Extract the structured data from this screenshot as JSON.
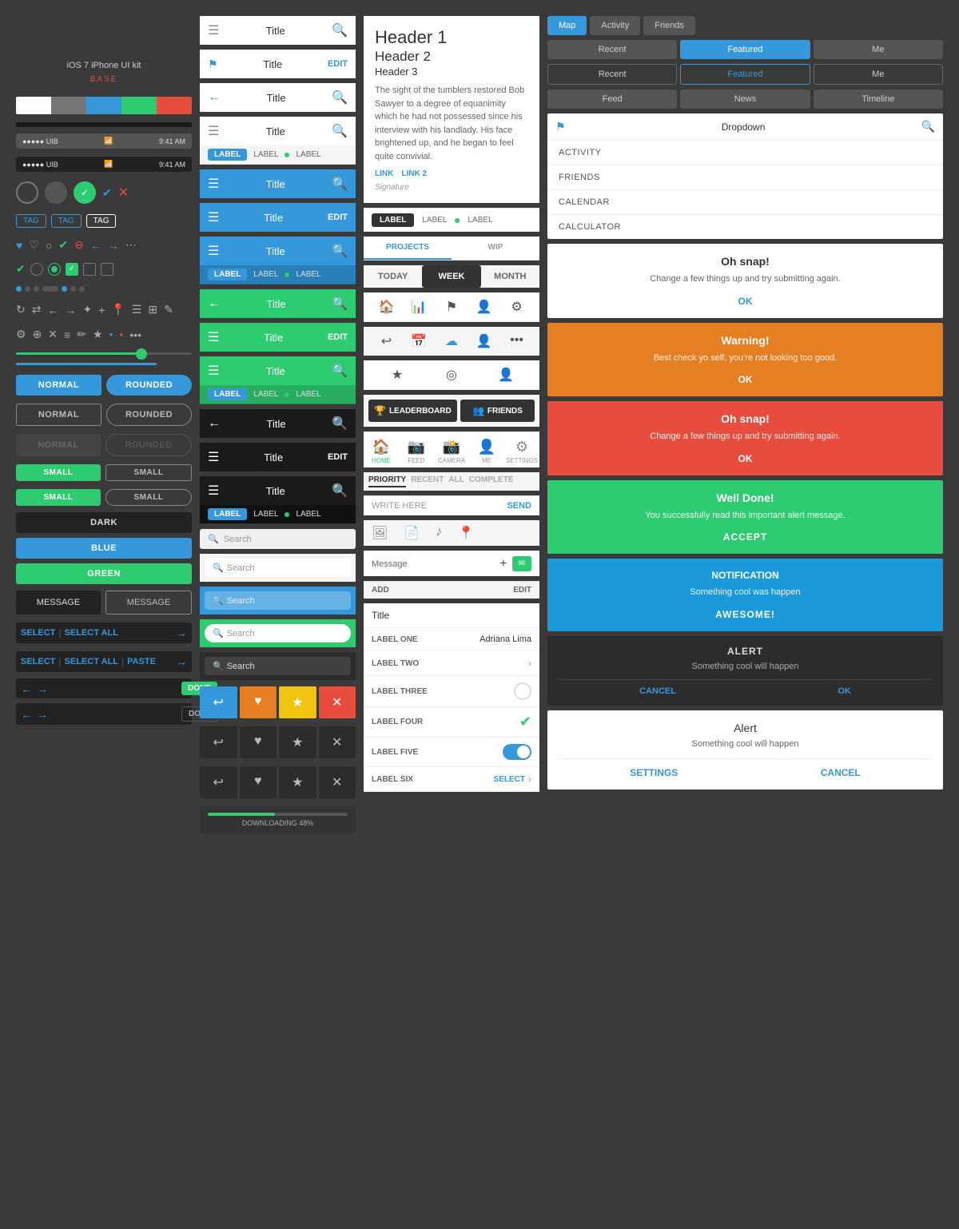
{
  "kit": {
    "title": "iOS 7 iPhone UI kit",
    "subtitle": "BASE",
    "colors": [
      "#fff",
      "#777",
      "#3498db",
      "#2ecc71",
      "#e74c3c"
    ],
    "phone_status": "9:41 AM",
    "phone_carrier": "UIB"
  },
  "buttons": {
    "normal": "NORMAL",
    "rounded": "ROUNDED",
    "dark": "DARK",
    "blue": "BLUE",
    "green": "GREEN",
    "small": "SMALL",
    "message": "MESSAGE",
    "select": "SELECT",
    "select_all": "SELECT ALL",
    "paste": "PASTE",
    "done": "DONE"
  },
  "nav": {
    "title": "Title",
    "edit": "EDIT",
    "label": "LABEL",
    "search_placeholder": "Search"
  },
  "article": {
    "header1": "Header 1",
    "header2": "Header 2",
    "header3": "Header 3",
    "body": "The sight of the tumblers restored Bob Sawyer to a degree of equanimity which he had not possessed since his interview with his landlady. His face brightened up, and he began to feel quite convivial.",
    "link1": "LINK",
    "link2": "LINK 2",
    "signature": "Signature"
  },
  "tabs": {
    "projects": "PROJECTS",
    "wip": "WIP",
    "today": "TODAY",
    "week": "WEEK",
    "month": "MONTH",
    "priority": "PRIORITY",
    "recent": "RECENT",
    "all": "ALL",
    "complete": "COMPLETE"
  },
  "col4_tabs": {
    "map": "Map",
    "activity": "Activity",
    "friends": "Friends",
    "recent": "Recent",
    "featured": "Featured",
    "me": "Me",
    "feed": "Feed",
    "news": "News",
    "timeline": "Timeline"
  },
  "dropdown": {
    "title": "Dropdown",
    "items": [
      "ACTIVITY",
      "FRIENDS",
      "CALENDAR",
      "CALCULATOR"
    ]
  },
  "alerts": {
    "oh_snap_title": "Oh snap!",
    "oh_snap_body": "Change a few things up and try submitting again.",
    "ok": "OK",
    "warning_title": "Warning!",
    "warning_body": "Best check yo self, you're not looking too good.",
    "danger_title": "Oh snap!",
    "danger_body": "Change a few things up and try submitting again.",
    "success_title": "Well Done!",
    "success_body": "You successfully read this important alert message.",
    "accept": "ACCEPT",
    "notification_title": "Notification",
    "notification_body": "Something cool was happen",
    "awesome": "AWESOME!",
    "dark_alert1_title": "ALERT",
    "dark_alert1_body": "Something cool will happen",
    "cancel": "CANCEL",
    "dark_alert2_title": "Alert",
    "dark_alert2_body": "Something cool will happen",
    "settings": "SETTINGS"
  },
  "form": {
    "title": "Title",
    "label_one": "LABEL ONE",
    "label_two": "LABEL TWO",
    "label_three": "LABEL THREE",
    "label_four": "LABEL FOUR",
    "label_five": "LABEL FIVE",
    "label_six": "LABEL SIX",
    "value_one": "Adriana Lima",
    "select_text": "SELECT"
  },
  "bottom_nav": {
    "home": "HOME",
    "feed": "FEED",
    "camera": "CAMERA",
    "me": "ME",
    "settings": "SETTINGS"
  },
  "leaderboard": {
    "label": "LEADERBOARD",
    "friends": "FRIENDS"
  },
  "messaging": {
    "write_here": "WRITE HERE",
    "send": "SEND",
    "message": "Message",
    "add": "ADD",
    "edit": "EDIT"
  },
  "progress": {
    "label": "DOWNLOADING 48%",
    "percent": 48
  }
}
